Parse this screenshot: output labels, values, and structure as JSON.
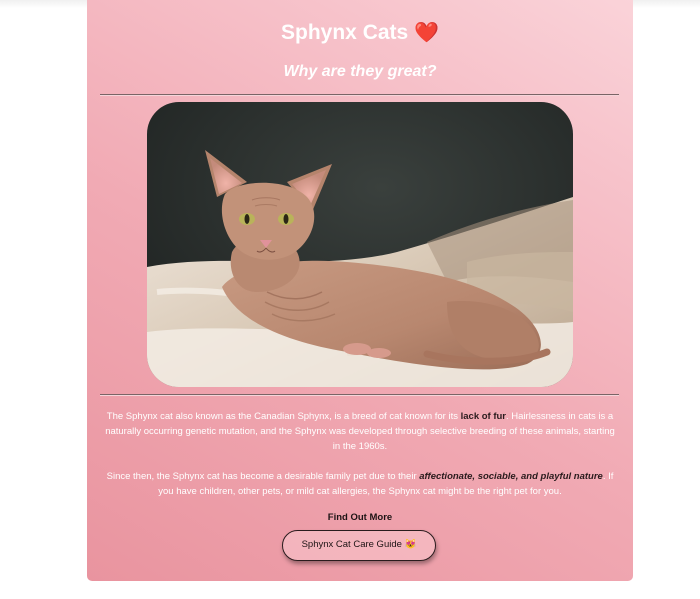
{
  "header": {
    "title": "Sphynx Cats",
    "title_emoji": "❤️",
    "subtitle": "Why are they great?"
  },
  "image": {
    "alt_semantic": "sphynx-cat-photo"
  },
  "body": {
    "p1_before": "The Sphynx cat also known as the Canadian Sphynx, is a breed of cat known for its ",
    "p1_bold": "lack of fur",
    "p1_after": ". Hairlessness in cats is a naturally occurring genetic mutation, and the Sphynx was developed through selective breeding of these animals, starting in the 1960s.",
    "p2_before": "Since then, the Sphynx cat has become a desirable family pet due to their ",
    "p2_emph": "affectionate, sociable, and playful nature",
    "p2_after": ". If you have children, other pets, or mild cat allergies, the Sphynx cat might be the right pet for you."
  },
  "cta": {
    "heading": "Find Out More",
    "button_label": "Sphynx Cat Care Guide",
    "button_emoji": "😻"
  },
  "colors": {
    "card_gradient_start": "#e9949f",
    "card_gradient_end": "#fad3d9",
    "text_on_card": "#ffffff",
    "dark_text": "#2a1b1d",
    "heart": "#e8192c"
  }
}
